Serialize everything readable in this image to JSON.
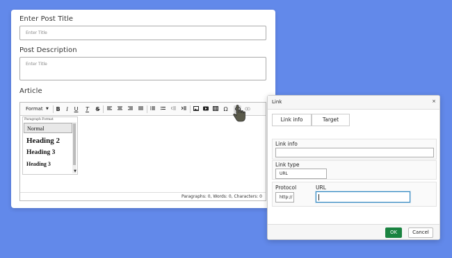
{
  "form": {
    "post_title_label": "Enter Post Title",
    "post_title_placeholder": "Enter Title",
    "post_description_label": "Post Description",
    "post_description_placeholder": "Enter Title",
    "article_label": "Article"
  },
  "toolbar": {
    "format_label": "Format",
    "bold": "B",
    "italic": "I",
    "underline": "U",
    "clear_format": "T",
    "strikethrough": "S",
    "special_char": "Ω"
  },
  "format_dropdown": {
    "title": "Paragraph Format",
    "items": [
      "Normal",
      "Heading 2",
      "Heading 3",
      "Heading 3"
    ]
  },
  "statusbar": {
    "text": "Paragraphs: 0, Words: 0, Characters: 0"
  },
  "link_dialog": {
    "title": "Link",
    "close": "×",
    "tabs": [
      "Link info",
      "Target"
    ],
    "link_info_label": "Link info",
    "link_type_label": "Link type",
    "link_type_value": "URL",
    "protocol_label": "Protocol",
    "protocol_value": "http://",
    "url_label": "URL",
    "ok_label": "OK",
    "cancel_label": "Cancel"
  },
  "colors": {
    "background": "#6289ea",
    "ok_button": "#1a8340",
    "url_focus": "#2e86c1"
  }
}
